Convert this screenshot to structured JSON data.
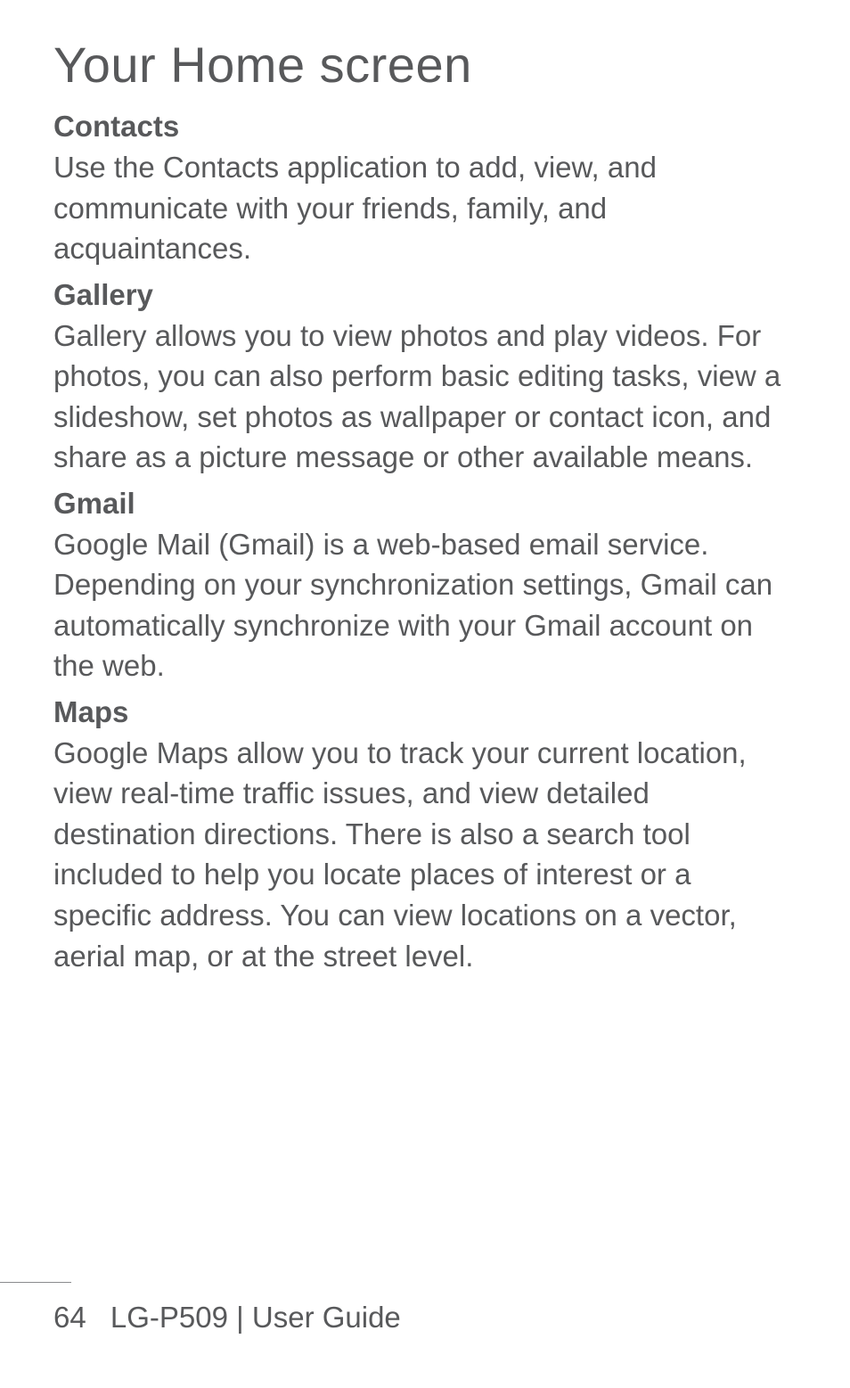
{
  "page": {
    "title": "Your Home screen",
    "sections": [
      {
        "heading": "Contacts",
        "body": "Use the Contacts application to add, view, and communicate with your friends, family, and acquaintances."
      },
      {
        "heading": "Gallery",
        "body": "Gallery allows you to view photos and play videos. For photos, you can also perform basic editing tasks, view a slideshow, set photos as wallpaper or contact icon, and share as a picture message or other available means."
      },
      {
        "heading": "Gmail",
        "body": "Google Mail (Gmail) is a web-based email service. Depending on your synchronization settings, Gmail can automatically synchronize with your Gmail account on the web."
      },
      {
        "heading": "Maps",
        "body": "Google Maps allow you to track your current location, view real-time traffic issues, and view detailed destination directions. There is also a search tool included to help you locate places of interest or a specific address. You can view locations on a vector, aerial map, or at the street level."
      }
    ],
    "footer": {
      "page_number": "64",
      "doc_label": "LG-P509  |  User Guide"
    }
  }
}
